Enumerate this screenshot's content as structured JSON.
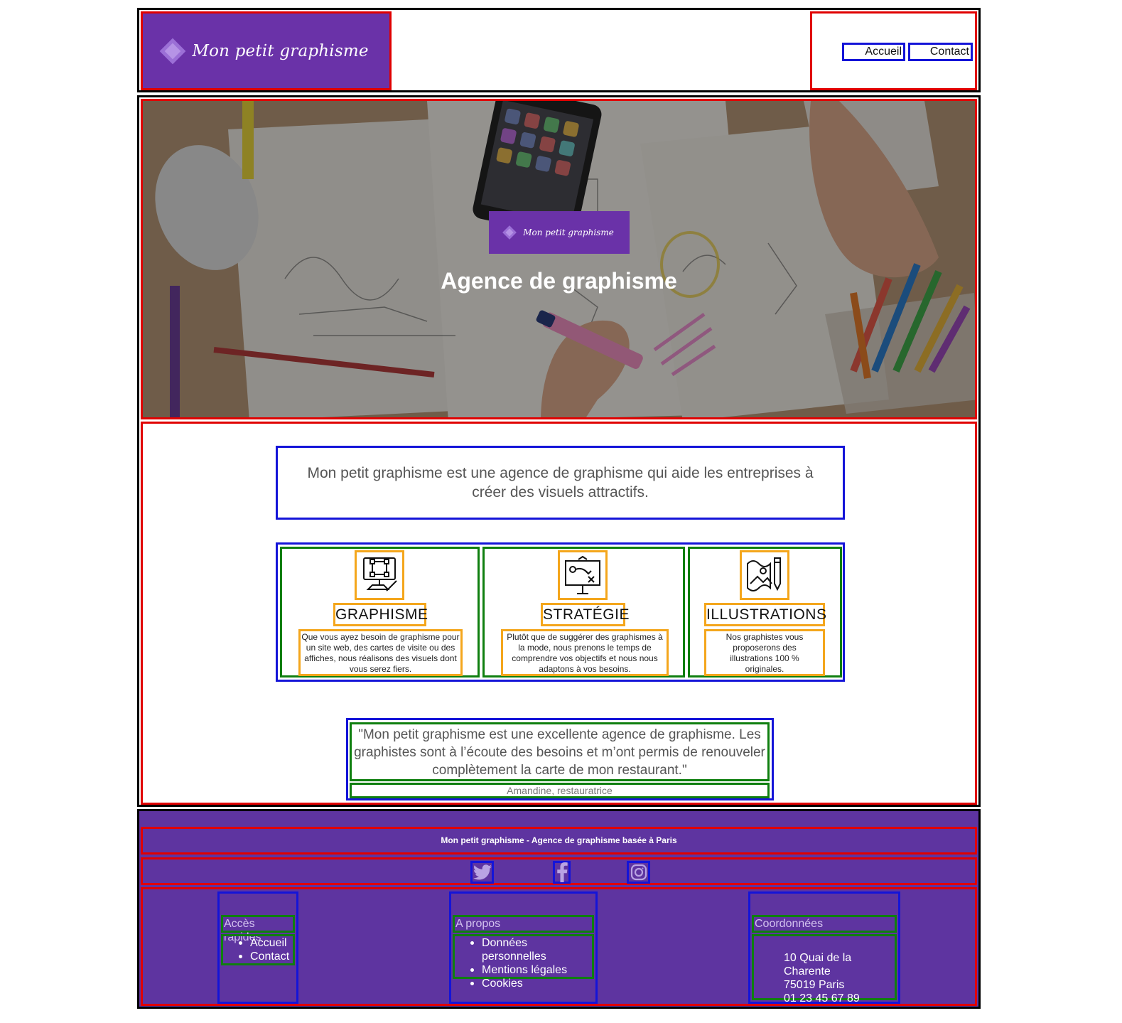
{
  "header": {
    "logo_text": "Mon petit graphisme",
    "nav": {
      "home": "Accueil",
      "contact": "Contact"
    }
  },
  "hero": {
    "badge_text": "Mon petit graphisme",
    "title": "Agence de graphisme"
  },
  "intro": {
    "text": "Mon petit graphisme est une agence de graphisme qui aide les entreprises à créer des visuels attractifs."
  },
  "services": [
    {
      "icon": "computer-design-icon",
      "title": "GRAPHISME",
      "description": "Que vous ayez besoin de graphisme pour un site web, des cartes de visite ou des affiches, nous réalisons des visuels dont vous serez fiers."
    },
    {
      "icon": "strategy-board-icon",
      "title": "STRATÉGIE",
      "description": "Plutôt que de suggérer des graphismes à la mode, nous prenons le temps de comprendre vos objectifs et nous nous adaptons à vos besoins."
    },
    {
      "icon": "illustration-map-icon",
      "title": "ILLUSTRATIONS",
      "description": "Nos graphistes vous proposerons des illustrations 100 % originales."
    }
  ],
  "testimonial": {
    "quote": "\"Mon petit graphisme est une excellente agence de graphisme. Les graphistes sont à l’écoute des besoins et m’ont permis de renouveler complètement la carte de mon restaurant.\"",
    "author": "Amandine, restauratrice"
  },
  "footer": {
    "tagline": "Mon petit graphisme - Agence de graphisme basée à Paris",
    "social": [
      "twitter-icon",
      "facebook-icon",
      "instagram-icon"
    ],
    "columns": {
      "quick_access": {
        "title": "Accès rapides",
        "items": [
          "Accueil",
          "Contact"
        ]
      },
      "about": {
        "title": "A propos",
        "items": [
          "Données personnelles",
          "Mentions légales",
          "Cookies"
        ]
      },
      "contact": {
        "title": "Coordonnées",
        "lines": [
          "10 Quai de la Charente",
          "75019 Paris",
          "01 23 45 67 89"
        ]
      }
    }
  },
  "colors": {
    "brand_purple": "#6a32a8",
    "footer_purple": "#5e34a0",
    "outline_red": "#e00000",
    "outline_blue": "#1414d8",
    "outline_green": "#0f7f0f",
    "outline_orange": "#f4a61c"
  }
}
